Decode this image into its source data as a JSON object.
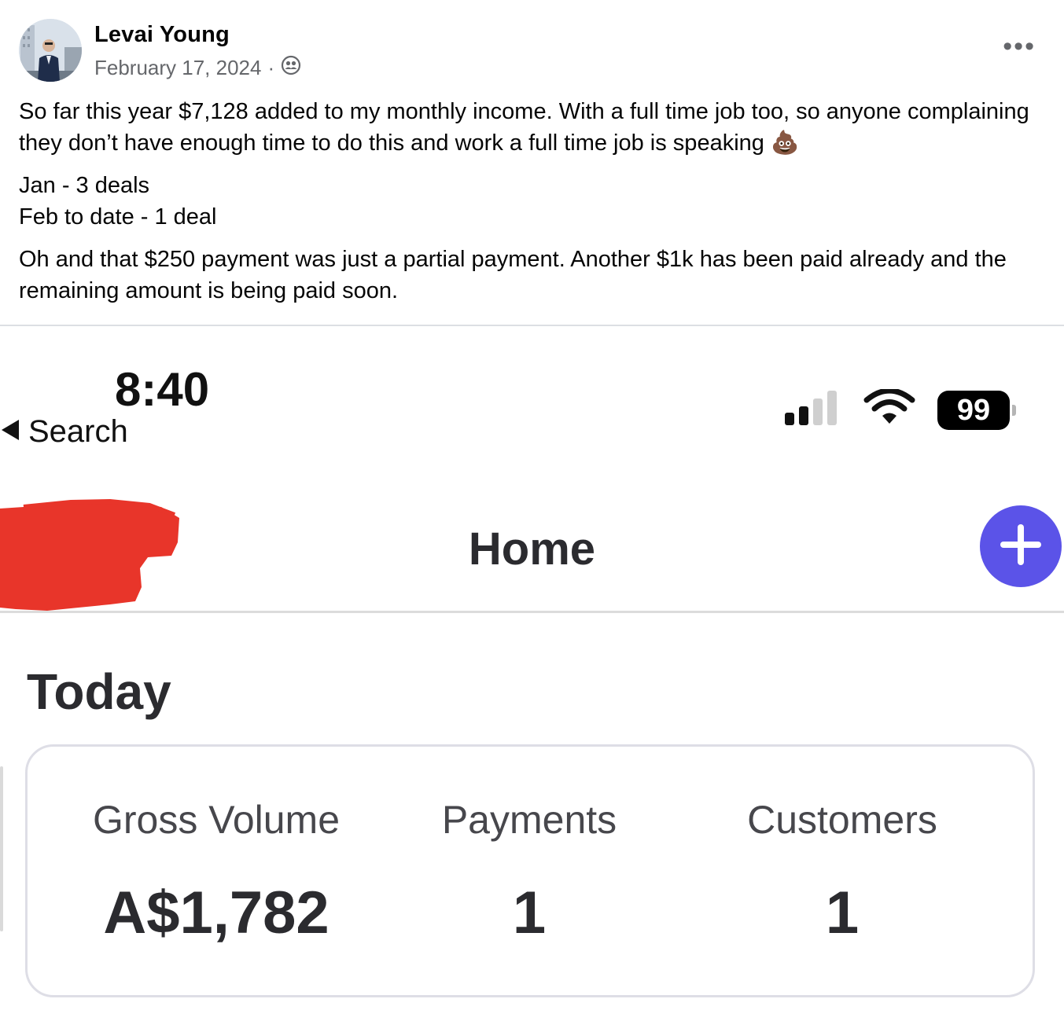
{
  "post": {
    "author_name": "Levai Young",
    "date": "February 17, 2024",
    "date_separator": "·",
    "privacy_icon": "friends-icon",
    "more_icon": "more-options-icon",
    "more_label": "•••",
    "paragraph_1": "So far this year $7,128 added to my monthly income. With a full time job too, so anyone complaining they don’t have enough time to do this and work a full time job is speaking 💩",
    "line_jan": "Jan - 3 deals",
    "line_feb": "Feb to date - 1 deal",
    "paragraph_3": "Oh and that $250 payment was just a partial payment. Another $1k has been paid already and the remaining amount is being paid soon."
  },
  "screenshot": {
    "status_bar": {
      "time": "8:40",
      "back_label": "Search",
      "battery": "99",
      "signal_bars_filled": 2,
      "signal_bars_total": 4
    },
    "nav": {
      "title": "Home",
      "add_icon": "plus-icon"
    },
    "section_title": "Today",
    "stats": [
      {
        "label": "Gross Volume",
        "value": "A$1,782"
      },
      {
        "label": "Payments",
        "value": "1"
      },
      {
        "label": "Customers",
        "value": "1"
      }
    ],
    "colors": {
      "accent": "#5b53e8",
      "redaction": "#e8352a"
    }
  }
}
